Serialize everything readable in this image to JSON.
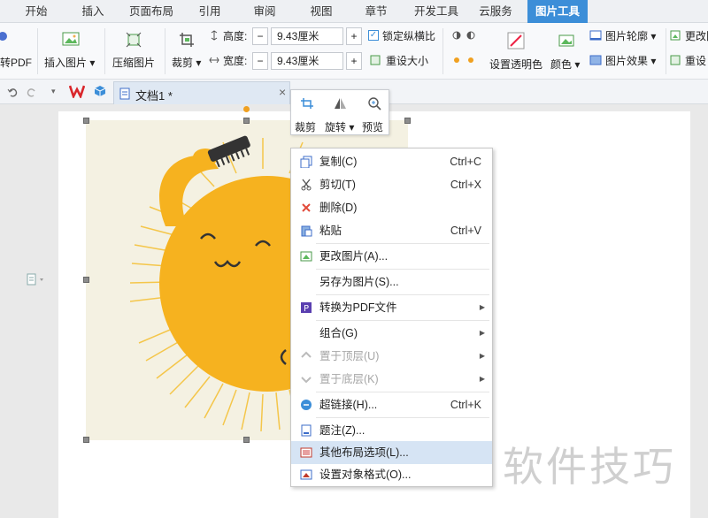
{
  "tabs": [
    "开始",
    "插入",
    "页面布局",
    "引用",
    "审阅",
    "视图",
    "章节",
    "开发工具",
    "云服务",
    "图片工具"
  ],
  "ribbon": {
    "to_pdf": "转PDF",
    "insert_picture": "插入图片",
    "compress_picture": "压缩图片",
    "crop": "裁剪",
    "height_label": "高度:",
    "width_label": "宽度:",
    "height_value": "9.43厘米",
    "width_value": "9.43厘米",
    "minus": "−",
    "plus": "+",
    "lock_ratio": "锁定纵横比",
    "reset_size": "重设大小",
    "set_transparent": "设置透明色",
    "color": "颜色",
    "picture_outline": "图片轮廓",
    "picture_effect": "图片效果",
    "change_picture": "更改图",
    "reset_picture": "重设"
  },
  "doc_tab": {
    "title": "文档1 *",
    "close": "×"
  },
  "mini_toolbar": {
    "crop": "裁剪",
    "rotate": "旋转",
    "preview": "预览"
  },
  "context_menu": [
    {
      "label": "复制(C)",
      "shortcut": "Ctrl+C",
      "icon": "copy-icon"
    },
    {
      "label": "剪切(T)",
      "shortcut": "Ctrl+X",
      "icon": "cut-icon"
    },
    {
      "label": "删除(D)",
      "shortcut": "",
      "icon": "delete-icon"
    },
    {
      "label": "粘贴",
      "shortcut": "Ctrl+V",
      "icon": "paste-icon"
    },
    {
      "label": "更改图片(A)...",
      "shortcut": "",
      "icon": "change-picture-icon"
    },
    {
      "label": "另存为图片(S)...",
      "shortcut": "",
      "icon": ""
    },
    {
      "label": "转换为PDF文件",
      "shortcut": "",
      "icon": "pdf-icon"
    },
    {
      "label": "组合(G)",
      "shortcut": "",
      "icon": ""
    },
    {
      "label": "置于顶层(U)",
      "shortcut": "",
      "icon": "bring-front-icon"
    },
    {
      "label": "置于底层(K)",
      "shortcut": "",
      "icon": "send-back-icon"
    },
    {
      "label": "超链接(H)...",
      "shortcut": "Ctrl+K",
      "icon": "hyperlink-icon"
    },
    {
      "label": "题注(Z)...",
      "shortcut": "",
      "icon": "caption-icon"
    },
    {
      "label": "其他布局选项(L)...",
      "shortcut": "",
      "icon": "layout-options-icon"
    },
    {
      "label": "设置对象格式(O)...",
      "shortcut": "",
      "icon": "format-object-icon"
    }
  ],
  "watermark": "软件技巧",
  "colors": {
    "accent": "#3c8ed8",
    "sun": "#f6b21f",
    "menu_highlight": "#d6e4f4"
  }
}
